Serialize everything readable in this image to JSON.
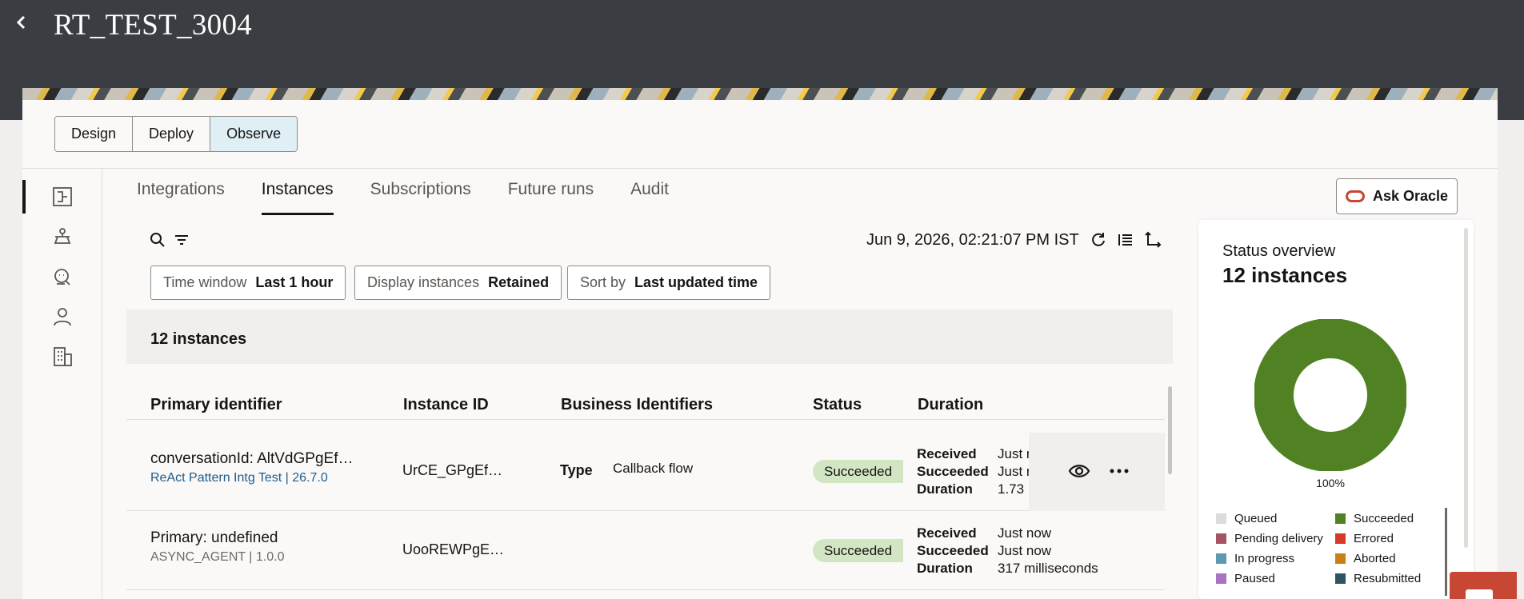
{
  "header": {
    "back_icon": "chevron-left-icon",
    "title": "RT_TEST_3004"
  },
  "mode_tabs": [
    {
      "label": "Design"
    },
    {
      "label": "Deploy"
    },
    {
      "label": "Observe"
    }
  ],
  "rail": [
    "integrations-icon",
    "agent-icon",
    "support-agent-icon",
    "user-icon",
    "building-icon"
  ],
  "tabs": [
    {
      "label": "Integrations"
    },
    {
      "label": "Instances"
    },
    {
      "label": "Subscriptions"
    },
    {
      "label": "Future runs"
    },
    {
      "label": "Audit"
    }
  ],
  "ask_oracle": {
    "label": "Ask Oracle"
  },
  "toolbar": {
    "timestamp": "Jun 9, 2026, 02:21:07 PM IST"
  },
  "filters": [
    {
      "label": "Time window",
      "value": "Last 1 hour"
    },
    {
      "label": "Display instances",
      "value": "Retained"
    },
    {
      "label": "Sort by",
      "value": "Last updated time"
    }
  ],
  "table": {
    "count": "12 instances",
    "columns": [
      "Primary identifier",
      "Instance ID",
      "Business Identifiers",
      "Status",
      "Duration"
    ],
    "rows": [
      {
        "primary": "conversationId: AltVdGPgEf…",
        "sub": "ReAct Pattern Intg Test | 26.7.0",
        "instance_id": "UrCE_GPgEf…",
        "biz_key": "Type",
        "biz_value": "Callback flow",
        "status": "Succeeded",
        "received_label": "Received",
        "received": "Just r",
        "succeeded_label": "Succeeded",
        "succeeded": "Just r",
        "duration_label": "Duration",
        "duration": "1.73"
      },
      {
        "primary": "Primary: undefined",
        "sub": "ASYNC_AGENT | 1.0.0",
        "instance_id": "UooREWPgE…",
        "biz_key": "",
        "biz_value": "",
        "status": "Succeeded",
        "received_label": "Received",
        "received": "Just now",
        "succeeded_label": "Succeeded",
        "succeeded": "Just now",
        "duration_label": "Duration",
        "duration": "317 milliseconds"
      }
    ]
  },
  "status_overview": {
    "title": "Status overview",
    "count": "12 instances",
    "percent": "100%",
    "succeeded_fraction": 1.0,
    "legend": [
      {
        "label": "Queued",
        "color": "#dcdcdc"
      },
      {
        "label": "Succeeded",
        "color": "#508223"
      },
      {
        "label": "Pending delivery",
        "color": "#a65366"
      },
      {
        "label": "Errored",
        "color": "#d63b25"
      },
      {
        "label": "In progress",
        "color": "#5b9ab0"
      },
      {
        "label": "Aborted",
        "color": "#c78114"
      },
      {
        "label": "Paused",
        "color": "#a873c3"
      },
      {
        "label": "Resubmitted",
        "color": "#2f5462"
      }
    ]
  }
}
